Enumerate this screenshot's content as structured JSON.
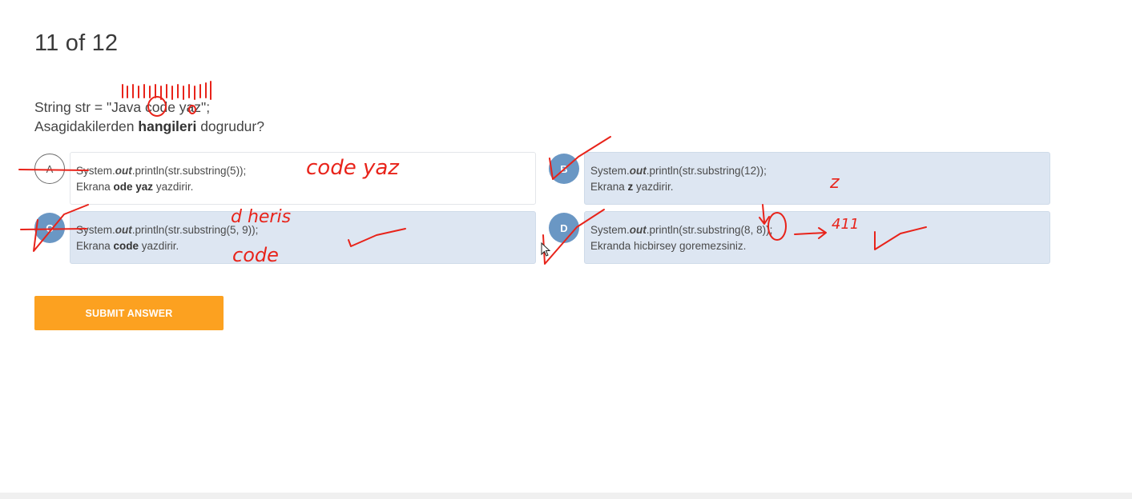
{
  "header": {
    "progress_text": "11 of 12"
  },
  "question": {
    "line1": "String str = \"Java code yaz\";",
    "line2_prefix": "Asagidakilerden ",
    "line2_bold": "hangileri",
    "line2_suffix": " dogrudur?"
  },
  "options": [
    {
      "letter": "A",
      "selected": false,
      "code_prefix": "System.",
      "code_italic": "out",
      "code_suffix": ".println(str.substring(5));",
      "desc_prefix": "Ekrana ",
      "desc_bold": "ode yaz",
      "desc_suffix": " yazdirir."
    },
    {
      "letter": "B",
      "selected": true,
      "code_prefix": "System.",
      "code_italic": "out",
      "code_suffix": ".println(str.substring(12));",
      "desc_prefix": "Ekrana ",
      "desc_bold": "z",
      "desc_suffix": " yazdirir."
    },
    {
      "letter": "C",
      "selected": true,
      "code_prefix": "System.",
      "code_italic": "out",
      "code_suffix": ".println(str.substring(5, 9));",
      "desc_prefix": "Ekrana ",
      "desc_bold": "code",
      "desc_suffix": " yazdirir."
    },
    {
      "letter": "D",
      "selected": true,
      "code_prefix": "System.",
      "code_italic": "out",
      "code_suffix": ".println(str.substring(8, 8));",
      "desc_prefix": "Ekranda hicbirsey goremezsiniz.",
      "desc_bold": "",
      "desc_suffix": ""
    }
  ],
  "submit": {
    "label": "SUBMIT ANSWER"
  },
  "annotations": {
    "color": "#e8231a",
    "note_a": "code yaz",
    "note_b": "z",
    "note_c_top": "d heris",
    "note_c_bottom": "code",
    "note_d": "411"
  },
  "colors": {
    "accent_button": "#fca120",
    "selected_badge": "#6a97c4",
    "selected_card": "#dde6f2"
  }
}
